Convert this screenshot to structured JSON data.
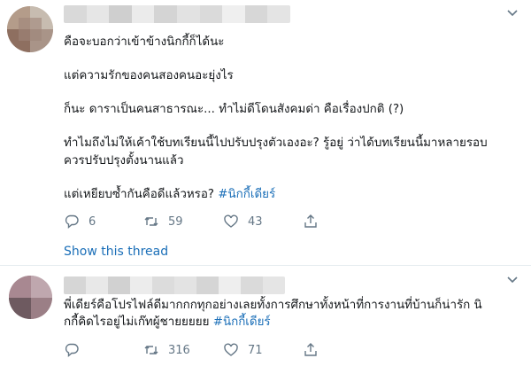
{
  "tweets": [
    {
      "lines": [
        "คือจะบอกว่าเข้าข้างนิกกี้ก็ได้นะ",
        "แต่ความรักของคนสองคนอะยุ่งไร",
        "ก็นะ ดาราเป็นคนสาธารณะ... ทำไม่ดีโดนสังคมด่า คือเรื่องปกติ (?)",
        "ทำไมถึงไม่ให้เค้าใช้บทเรียนนี้ไปปรับปรุงตัวเองอะ? รู้อยู่ ว่าได้บทเรียนนี้มาหลายรอบ",
        "ควรปรับปรุงตั้งนานแล้ว",
        "แต่เหยียบซ้ำกันคือดีแล้วหรอ?"
      ],
      "hashtag": "#นิกกี้เดียร์",
      "reply_count": "6",
      "retweet_count": "59",
      "like_count": "43",
      "show_thread": "Show this thread"
    },
    {
      "lines": [
        "พี่เดียร์คือโปรไฟล์ดีมากกกทุกอย่างเลยทั้งการศึกษาทั้งหน้าที่การงานที่บ้านก็น่ารัก นิ",
        "กกี้คิดไรอยู่ไม่เก๊ทผู้ชายยยยย"
      ],
      "hashtag": "#นิกกี้เดียร์",
      "retweet_count": "316",
      "like_count": "71"
    }
  ],
  "icons": {
    "reply": "reply-icon",
    "retweet": "retweet-icon",
    "like": "heart-icon",
    "share": "share-icon",
    "caret": "chevron-down-icon"
  },
  "colors": {
    "link": "#1b6fb8",
    "muted": "#657786",
    "text": "#14171a",
    "divider": "#e6ecf0"
  }
}
